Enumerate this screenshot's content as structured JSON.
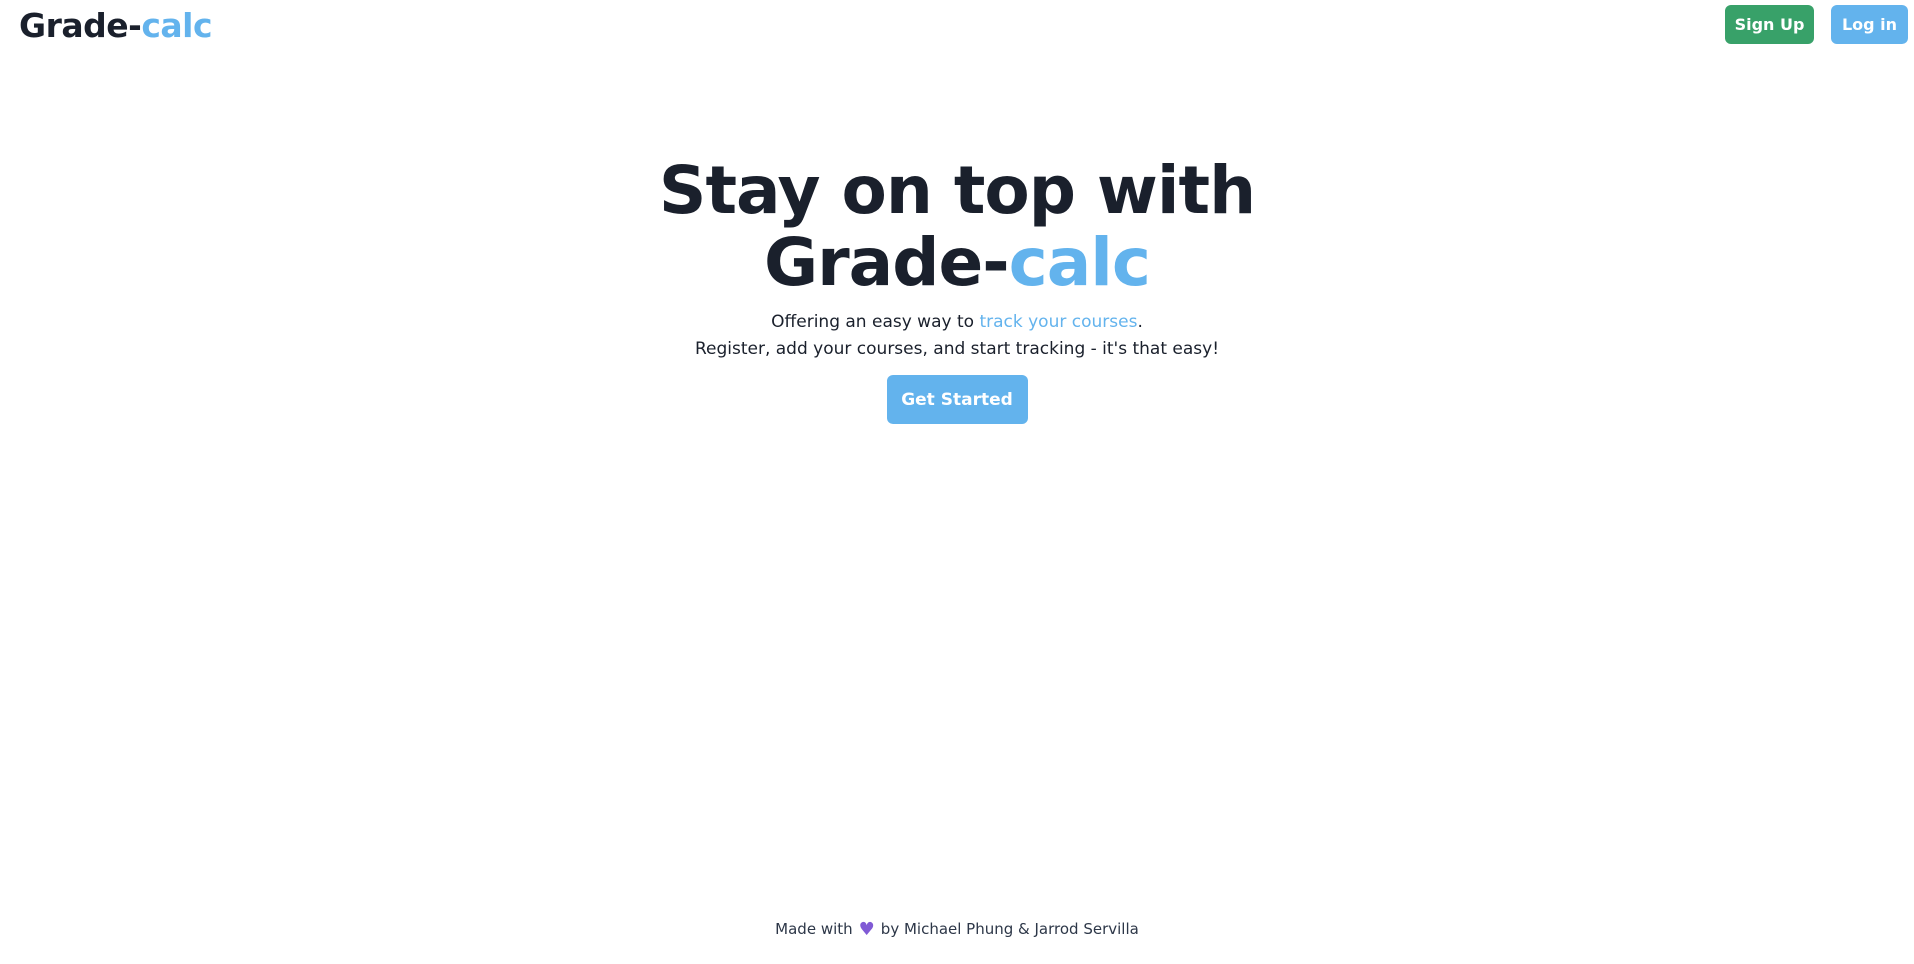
{
  "header": {
    "logo_main": "Grade-",
    "logo_accent": "calc",
    "signup_label": "Sign Up",
    "login_label": "Log in"
  },
  "hero": {
    "title_line1": "Stay on top with",
    "title_main": "Grade-",
    "title_accent": "calc",
    "sub_line1_prefix": "Offering an easy way to ",
    "sub_line1_link": "track your courses",
    "sub_line1_suffix": ".",
    "sub_line2": "Register, add your courses, and start tracking - it's that easy!",
    "cta_label": "Get Started"
  },
  "footer": {
    "prefix": "Made with",
    "heart_icon": "heart-icon",
    "heart_glyph": "♥",
    "suffix": "by Michael Phung & Jarrod Servilla"
  },
  "colors": {
    "accent": "#63b3ed",
    "signup": "#38a169",
    "text": "#1a202c",
    "heart": "#805ad5"
  }
}
